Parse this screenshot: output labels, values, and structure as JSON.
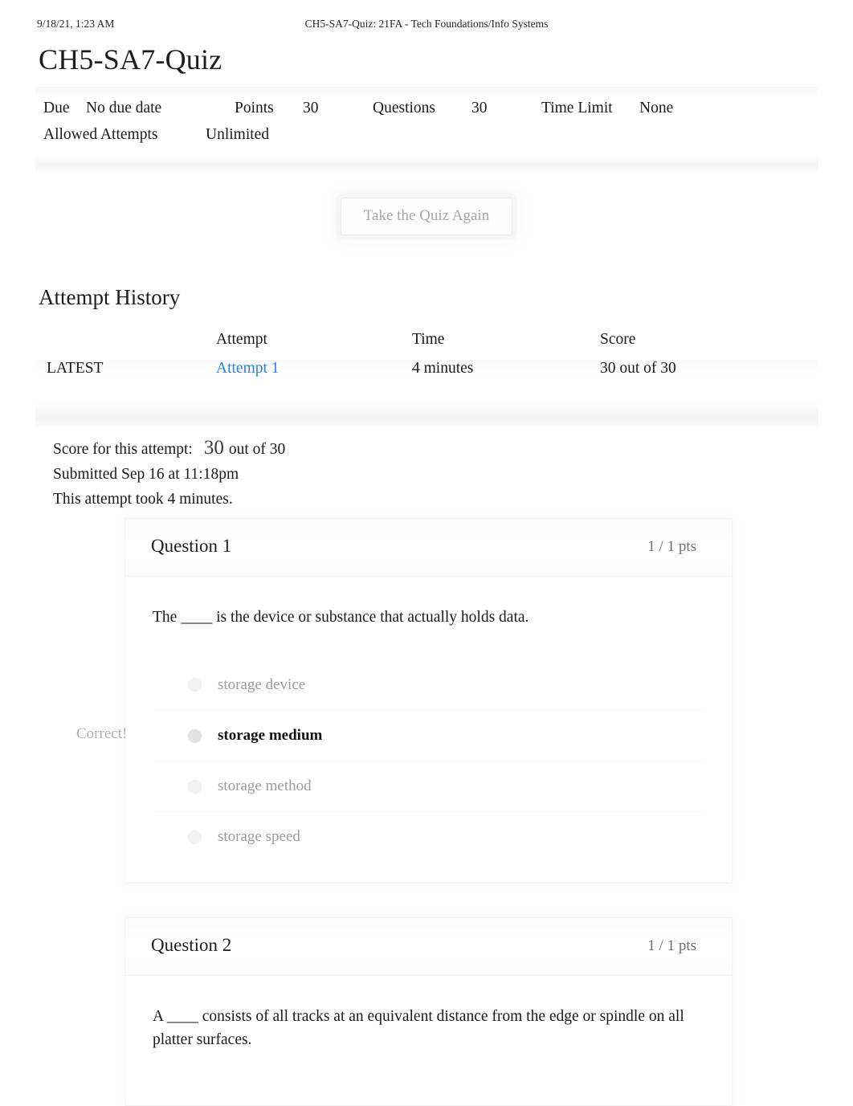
{
  "print_header": {
    "timestamp": "9/18/21, 1:23 AM",
    "document_title": "CH5-SA7-Quiz: 21FA - Tech Foundations/Info Systems"
  },
  "page_title": "CH5-SA7-Quiz",
  "quiz_meta": {
    "due_label": "Due",
    "due_value": "No due date",
    "points_label": "Points",
    "points_value": "30",
    "questions_label": "Questions",
    "questions_value": "30",
    "time_limit_label": "Time Limit",
    "time_limit_value": "None",
    "allowed_attempts_label": "Allowed Attempts",
    "allowed_attempts_value": "Unlimited"
  },
  "retake_button": {
    "label": "Take the Quiz Again"
  },
  "attempt_history": {
    "heading": "Attempt History",
    "columns": [
      "",
      "Attempt",
      "Time",
      "Score"
    ],
    "rows": [
      {
        "kept": "LATEST",
        "attempt": "Attempt 1",
        "time": "4 minutes",
        "score": "30 out of 30"
      }
    ]
  },
  "attempt_summary": {
    "score_label": "Score for this attempt:",
    "score_value": "30",
    "score_out_of": "out of 30",
    "submitted": "Submitted Sep 16 at 11:18pm",
    "duration": "This attempt took 4 minutes."
  },
  "questions": [
    {
      "title": "Question 1",
      "points": "1 / 1 pts",
      "text": "The ____ is the device or substance that actually holds data.",
      "result_flag": "Correct!",
      "answers": [
        {
          "label": "storage device",
          "selected": false
        },
        {
          "label": "storage medium",
          "selected": true
        },
        {
          "label": "storage method",
          "selected": false
        },
        {
          "label": "storage speed",
          "selected": false
        }
      ]
    },
    {
      "title": "Question 2",
      "points": "1 / 1 pts",
      "text": "A ____ consists of all tracks at an equivalent distance from the edge or spindle on all platter surfaces.",
      "result_flag": "",
      "answers": []
    }
  ],
  "colors": {
    "link_blue": "#2b7fe0",
    "muted_gray": "#9c9c9c",
    "text_black": "#1a1a1a"
  }
}
